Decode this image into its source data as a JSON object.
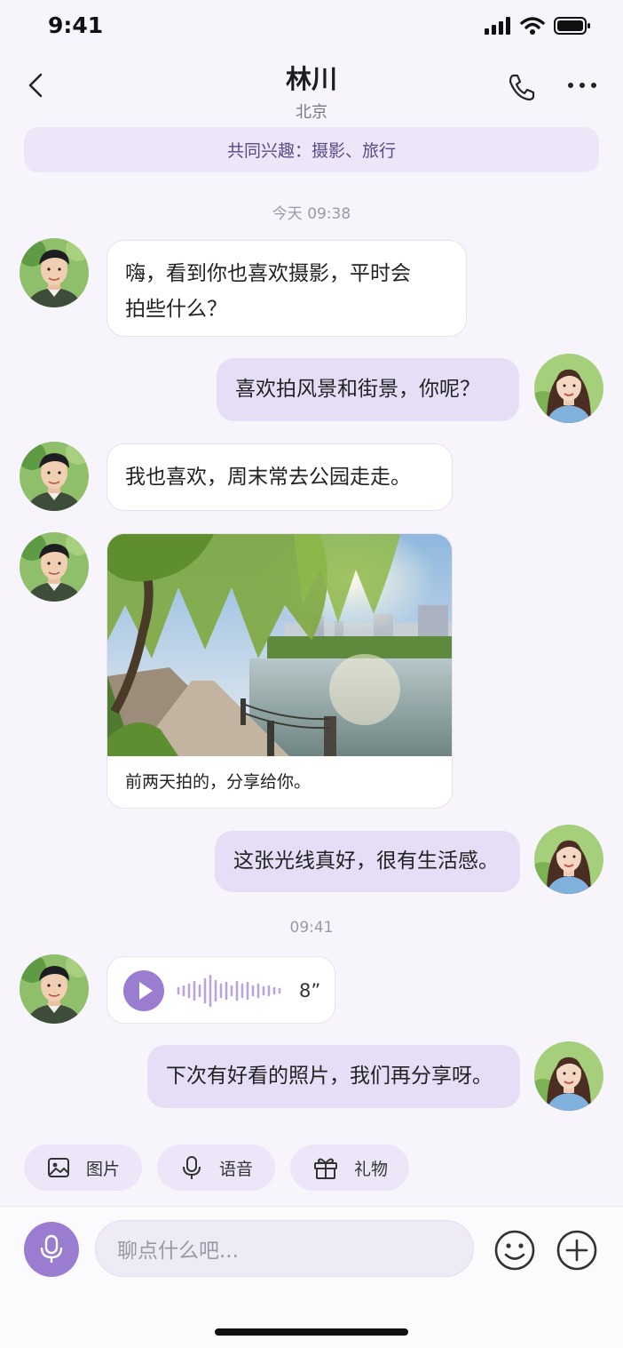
{
  "status_bar": {
    "time": "9:41",
    "icons": [
      "cellular-signal-icon",
      "wifi-icon",
      "battery-icon"
    ]
  },
  "header": {
    "back_icon": "chevron-left-icon",
    "title": "林川",
    "subtitle": "北京",
    "call_icon": "phone-icon",
    "more_icon": "more-dots-icon"
  },
  "interest_banner": "共同兴趣：摄影、旅行",
  "timestamps": [
    "今天 09:38",
    "09:41"
  ],
  "messages": [
    {
      "sender": "contact",
      "lines": [
        "嗨，看到你也喜欢摄影，平时会",
        "拍些什么？"
      ]
    },
    {
      "sender": "me",
      "text": "喜欢拍风景和街景，你呢？"
    },
    {
      "sender": "contact",
      "text": "我也喜欢，周末常去公园走走。"
    },
    {
      "sender": "contact",
      "type": "photo",
      "caption": "前两天拍的，分享给你。"
    },
    {
      "sender": "me",
      "text": "这张光线真好，很有生活感。"
    },
    {
      "sender": "contact",
      "type": "voice",
      "duration": "8”"
    },
    {
      "sender": "me",
      "text": "下次有好看的照片，我们再分享呀。"
    }
  ],
  "quick_actions": [
    {
      "label": "图片",
      "icon": "image-icon"
    },
    {
      "label": "语音",
      "icon": "microphone-icon"
    },
    {
      "label": "礼物",
      "icon": "gift-icon"
    }
  ],
  "composer": {
    "placeholder": "聊点什么吧...",
    "mic_icon": "microphone-icon",
    "emoji_icon": "emoji-icon",
    "add_icon": "plus-circle-icon"
  },
  "colors": {
    "accent": "#9a7cd1",
    "outgoing_bubble": "#e6def7",
    "banner": "#ece6f8",
    "background": "#f7f5fb"
  }
}
